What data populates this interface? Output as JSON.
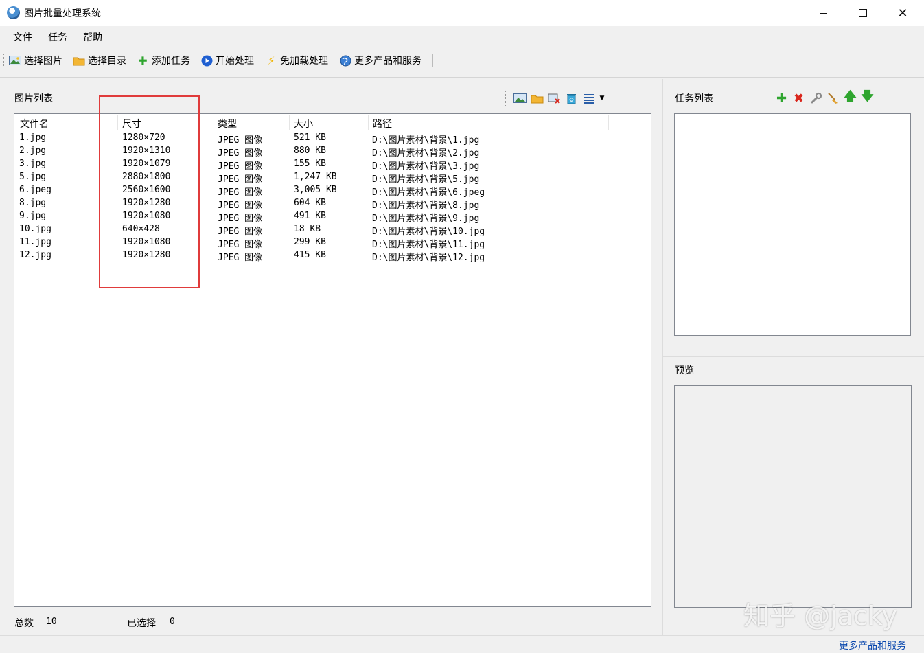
{
  "window": {
    "title": "图片批量处理系统",
    "min_glyph": "—",
    "max_glyph": "□",
    "close_glyph": "✕"
  },
  "menu": [
    "文件",
    "任务",
    "帮助"
  ],
  "toolbar": {
    "select_images": "选择图片",
    "select_directory": "选择目录",
    "add_task": "添加任务",
    "start_processing": "开始处理",
    "no_load_processing": "免加载处理",
    "more_products": "更多产品和服务"
  },
  "image_list": {
    "label": "图片列表",
    "columns": [
      "文件名",
      "尺寸",
      "类型",
      "大小",
      "路径"
    ],
    "rows": [
      [
        "1.jpg",
        "1280×720",
        "JPEG 图像",
        "521 KB",
        "D:\\图片素材\\背景\\1.jpg"
      ],
      [
        "2.jpg",
        "1920×1310",
        "JPEG 图像",
        "880 KB",
        "D:\\图片素材\\背景\\2.jpg"
      ],
      [
        "3.jpg",
        "1920×1079",
        "JPEG 图像",
        "155 KB",
        "D:\\图片素材\\背景\\3.jpg"
      ],
      [
        "5.jpg",
        "2880×1800",
        "JPEG 图像",
        "1,247 KB",
        "D:\\图片素材\\背景\\5.jpg"
      ],
      [
        "6.jpeg",
        "2560×1600",
        "JPEG 图像",
        "3,005 KB",
        "D:\\图片素材\\背景\\6.jpeg"
      ],
      [
        "8.jpg",
        "1920×1280",
        "JPEG 图像",
        "604 KB",
        "D:\\图片素材\\背景\\8.jpg"
      ],
      [
        "9.jpg",
        "1920×1080",
        "JPEG 图像",
        "491 KB",
        "D:\\图片素材\\背景\\9.jpg"
      ],
      [
        "10.jpg",
        "640×428",
        "JPEG 图像",
        "18 KB",
        "D:\\图片素材\\背景\\10.jpg"
      ],
      [
        "11.jpg",
        "1920×1080",
        "JPEG 图像",
        "299 KB",
        "D:\\图片素材\\背景\\11.jpg"
      ],
      [
        "12.jpg",
        "1920×1280",
        "JPEG 图像",
        "415 KB",
        "D:\\图片素材\\背景\\12.jpg"
      ]
    ]
  },
  "status": {
    "total_label": "总数",
    "total_value": "10",
    "selected_label": "已选择",
    "selected_value": "0"
  },
  "task_list": {
    "label": "任务列表"
  },
  "preview": {
    "label": "预览"
  },
  "footer": {
    "link": "更多产品和服务"
  },
  "watermark": "知乎 @jacky",
  "colors": {
    "highlight": "#e03b3b",
    "link": "#0645ad",
    "add_green": "#2fa52f",
    "delete_red": "#d9261c",
    "start_blue": "#1f5fd1"
  }
}
